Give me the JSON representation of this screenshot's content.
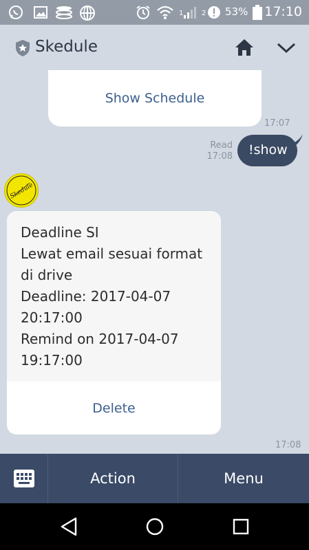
{
  "status_bar": {
    "battery_percent": "53%",
    "time": "17:10",
    "signal_label_1": "1",
    "signal_label_2": "2",
    "icons": [
      "whatsapp-icon",
      "gallery-icon",
      "storage-icon",
      "globe-icon",
      "alarm-icon",
      "wifi-icon",
      "signal-icon",
      "data-warning-icon",
      "battery-icon"
    ]
  },
  "header": {
    "title": "Skedule",
    "icons": [
      "shield-star-icon",
      "home-icon",
      "chevron-down-icon"
    ]
  },
  "chat": {
    "schedule_button_label": "Show Schedule",
    "schedule_time": "17:07",
    "sent_status": "Read",
    "sent_time": "17:08",
    "sent_message": "!show",
    "bot_avatar_label": "Skedule",
    "reminder": {
      "lines": [
        "Deadline SI",
        "Lewat email sesuai format",
        "di drive",
        "Deadline: 2017-04-07",
        "20:17:00",
        "Remind on 2017-04-07",
        "19:17:00"
      ],
      "delete_label": "Delete",
      "time": "17:08"
    }
  },
  "bottom_bar": {
    "action_label": "Action",
    "menu_label": "Menu",
    "keyboard_icon": "keyboard-icon"
  },
  "nav_bar": {
    "icons": [
      "back-icon",
      "home-circle-icon",
      "recents-icon"
    ]
  },
  "colors": {
    "header_bg": "#d3d9e2",
    "status_bg": "#939ba6",
    "bubble_sent": "#3b4a63",
    "link_blue": "#3c5f8f",
    "bottom_bar": "#3a4a67"
  }
}
